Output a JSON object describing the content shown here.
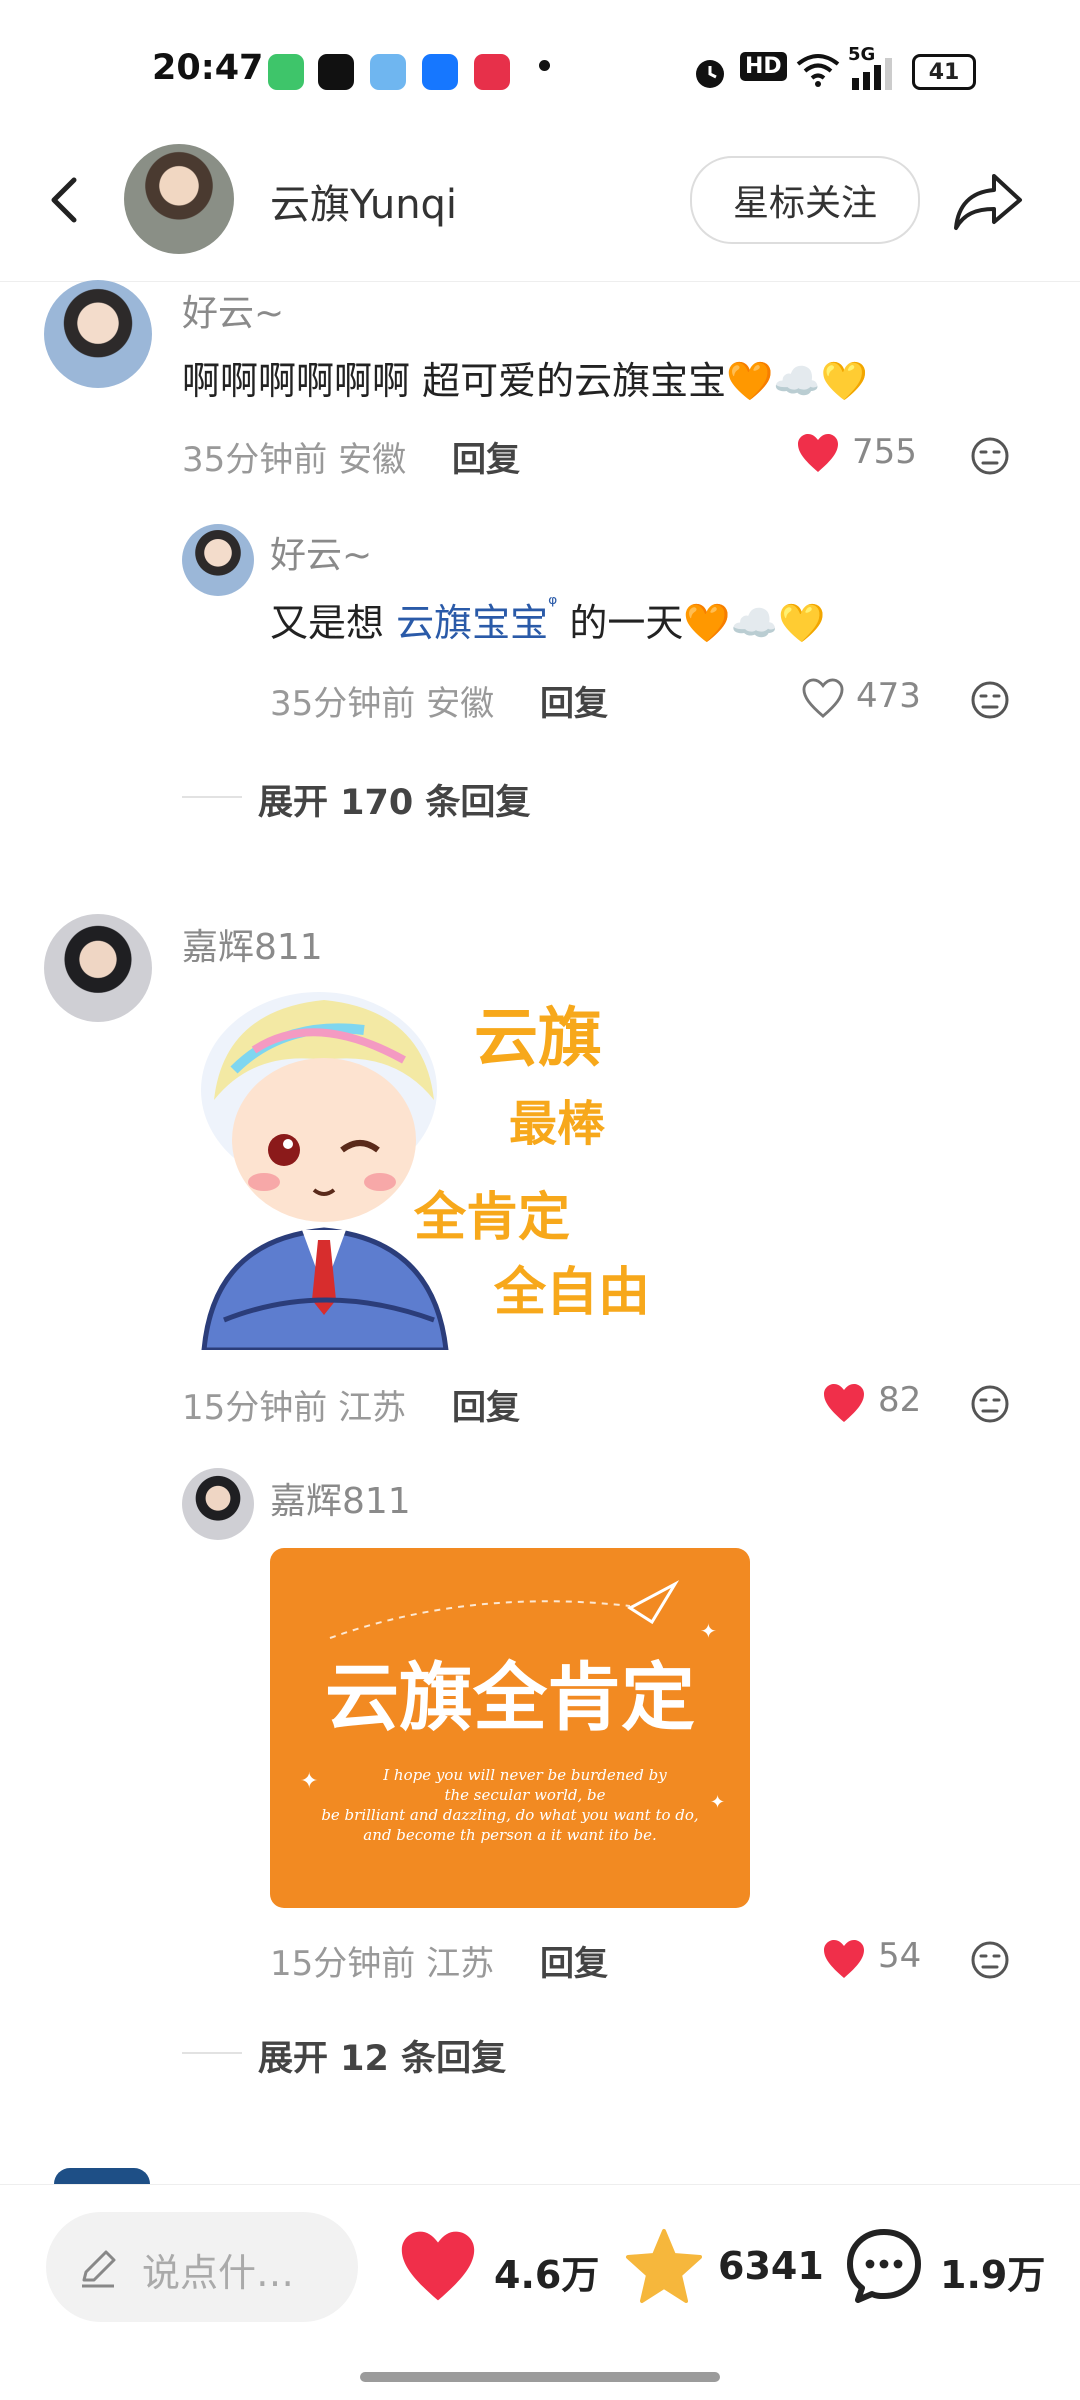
{
  "status_bar": {
    "time": "20:47",
    "battery": "41",
    "network": "5G",
    "hd": "HD"
  },
  "header": {
    "name": "云旗Yunqi",
    "follow_label": "星标关注"
  },
  "comments": [
    {
      "user": "好云~",
      "text": "啊啊啊啊啊啊 超可爱的云旗宝宝🧡☁️💛",
      "time": "35分钟前",
      "location": "安徽",
      "reply_label": "回复",
      "likes": "755",
      "liked": true,
      "replies": [
        {
          "user": "好云~",
          "text_prefix": "又是想",
          "mention": "云旗宝宝",
          "text_suffix": "的一天🧡☁️💛",
          "time": "35分钟前",
          "location": "安徽",
          "reply_label": "回复",
          "likes": "473",
          "liked": false
        }
      ],
      "expand_label": "展开 170 条回复"
    },
    {
      "user": "嘉辉811",
      "sticker_texts": [
        "云旗",
        "最棒",
        "全肯定",
        "全自由"
      ],
      "time": "15分钟前",
      "location": "江苏",
      "reply_label": "回复",
      "likes": "82",
      "liked": true,
      "replies": [
        {
          "user": "嘉辉811",
          "sticker_title": "云旗全肯定",
          "sticker_lines": [
            "I hope you will never be burdened by",
            "the secular world, be",
            "be brilliant and dazzling, do what you want to do,",
            "and become th person a it want ito be."
          ],
          "time": "15分钟前",
          "location": "江苏",
          "reply_label": "回复",
          "likes": "54",
          "liked": true
        }
      ],
      "expand_label": "展开 12 条回复"
    }
  ],
  "bottom_bar": {
    "placeholder": "说点什…",
    "likes": "4.6万",
    "favorites": "6341",
    "comments": "1.9万"
  },
  "colors": {
    "like_red": "#f02f4a",
    "star_yellow": "#f6b73c",
    "mention_blue": "#2a5aa8",
    "sticker_orange": "#f28a22"
  }
}
